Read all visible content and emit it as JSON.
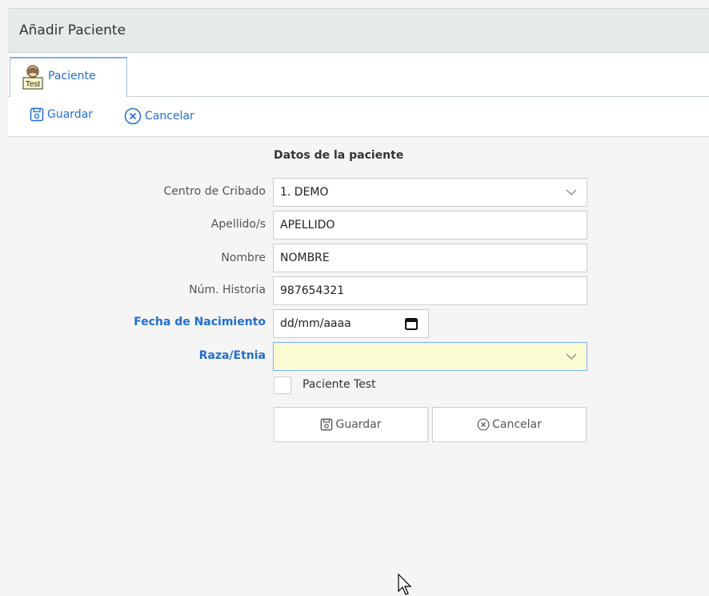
{
  "window": {
    "title": "Añadir Paciente"
  },
  "tabs": [
    {
      "label": "Paciente",
      "icon": "patient-test-icon",
      "icon_text": "Test"
    }
  ],
  "toolbar": {
    "save_label": "Guardar",
    "cancel_label": "Cancelar"
  },
  "form": {
    "section_title": "Datos de la paciente",
    "centro": {
      "label": "Centro de Cribado",
      "value": "1. DEMO"
    },
    "apellidos": {
      "label": "Apellido/s",
      "value": "APELLIDO"
    },
    "nombre": {
      "label": "Nombre",
      "value": "NOMBRE"
    },
    "historia": {
      "label": "Núm. Historia",
      "value": "987654321"
    },
    "fecha": {
      "label": "Fecha de Nacimiento",
      "placeholder": "dd/mm/aaaa"
    },
    "raza": {
      "label": "Raza/Etnia",
      "value": ""
    },
    "test": {
      "label": "Paciente Test",
      "checked": false
    },
    "save_label": "Guardar",
    "cancel_label": "Cancelar"
  },
  "colors": {
    "accent": "#1f6fd1",
    "title_bg": "#e4ebe9",
    "highlight": "#fbfbd4"
  }
}
